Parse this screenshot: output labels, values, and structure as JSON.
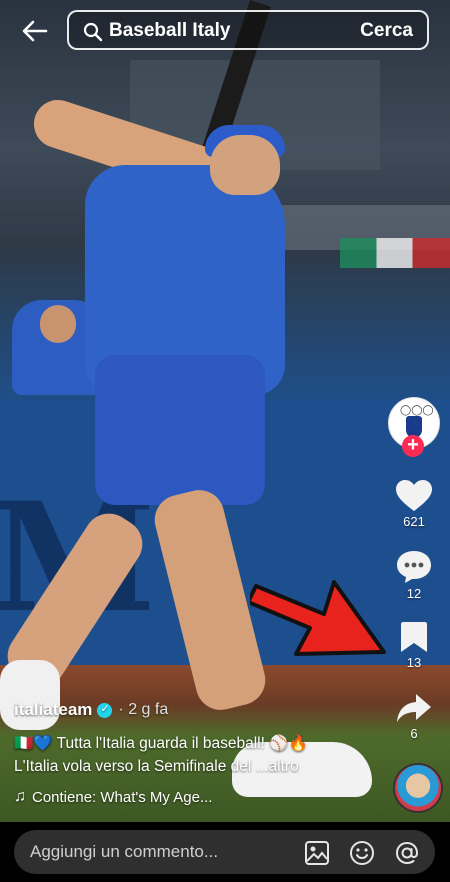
{
  "search": {
    "query": "Baseball Italy",
    "submit_label": "Cerca"
  },
  "actions": {
    "likes": "621",
    "comments": "12",
    "bookmarks": "13",
    "shares": "6"
  },
  "post": {
    "author": "italiateam",
    "date": "· 2 g fa",
    "caption_line1": "🇮🇹💙 Tutta l'Italia guarda il baseball! ⚾🔥",
    "caption_line2": "L'Italia vola verso la Semifinale del ...altro",
    "music": "Contiene: What's My Age..."
  },
  "comment_bar": {
    "placeholder": "Aggiungi un commento..."
  },
  "icons": {
    "back": "back-arrow-icon",
    "search": "search-icon",
    "like": "heart-icon",
    "comment": "comment-bubble-icon",
    "bookmark": "bookmark-icon",
    "share": "share-arrow-icon",
    "follow": "plus-icon",
    "music": "music-note-icon",
    "image": "image-icon",
    "emoji": "emoji-icon",
    "mention": "at-icon"
  },
  "colors": {
    "follow_red": "#fe2c55",
    "verified_blue": "#20d5ec",
    "annotation_arrow": "#e8221c"
  }
}
